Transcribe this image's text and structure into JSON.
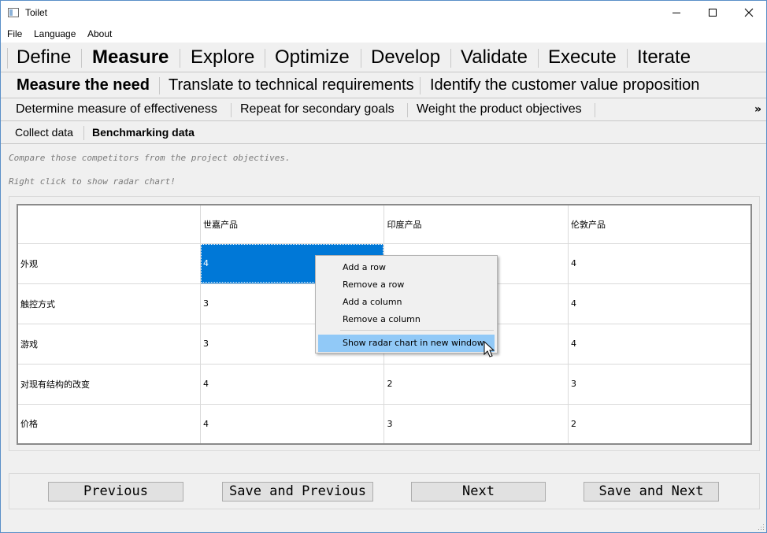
{
  "window": {
    "title": "Toilet"
  },
  "menubar": {
    "items": [
      "File",
      "Language",
      "About"
    ]
  },
  "phases": {
    "items": [
      "Define",
      "Measure",
      "Explore",
      "Optimize",
      "Develop",
      "Validate",
      "Execute",
      "Iterate"
    ],
    "active": "Measure"
  },
  "steps": {
    "items": [
      "Measure the need",
      "Translate to technical requirements",
      "Identify the customer value proposition"
    ],
    "active": "Measure the need"
  },
  "substeps": {
    "items": [
      "Determine measure of effectiveness",
      "Repeat for secondary goals",
      "Weight the product objectives"
    ],
    "more_symbol": "»"
  },
  "subtabs": {
    "items": [
      "Collect data",
      "Benchmarking data"
    ],
    "active": "Benchmarking data"
  },
  "hints": {
    "line1": "Compare those competitors from the project objectives.",
    "line2": "Right click to show radar chart!"
  },
  "table": {
    "columns": [
      "",
      "世嘉产品",
      "印度产品",
      "伦敦产品"
    ],
    "rows": [
      [
        "外观",
        "4",
        "",
        "4"
      ],
      [
        "触控方式",
        "3",
        "",
        "4"
      ],
      [
        "游戏",
        "3",
        "",
        "4"
      ],
      [
        "对现有结构的改变",
        "4",
        "2",
        "3"
      ],
      [
        "价格",
        "4",
        "3",
        "2"
      ]
    ]
  },
  "context_menu": {
    "items": [
      "Add a row",
      "Remove a row",
      "Add a column",
      "Remove a column",
      "Show radar chart in new window"
    ],
    "highlighted": "Show radar chart in new window"
  },
  "buttons": {
    "previous": "Previous",
    "save_previous": "Save and Previous",
    "next": "Next",
    "save_next": "Save and Next"
  },
  "colors": {
    "selection": "#0078d7",
    "menu_highlight": "#91c9f7",
    "window_border": "#5a8fc8"
  }
}
